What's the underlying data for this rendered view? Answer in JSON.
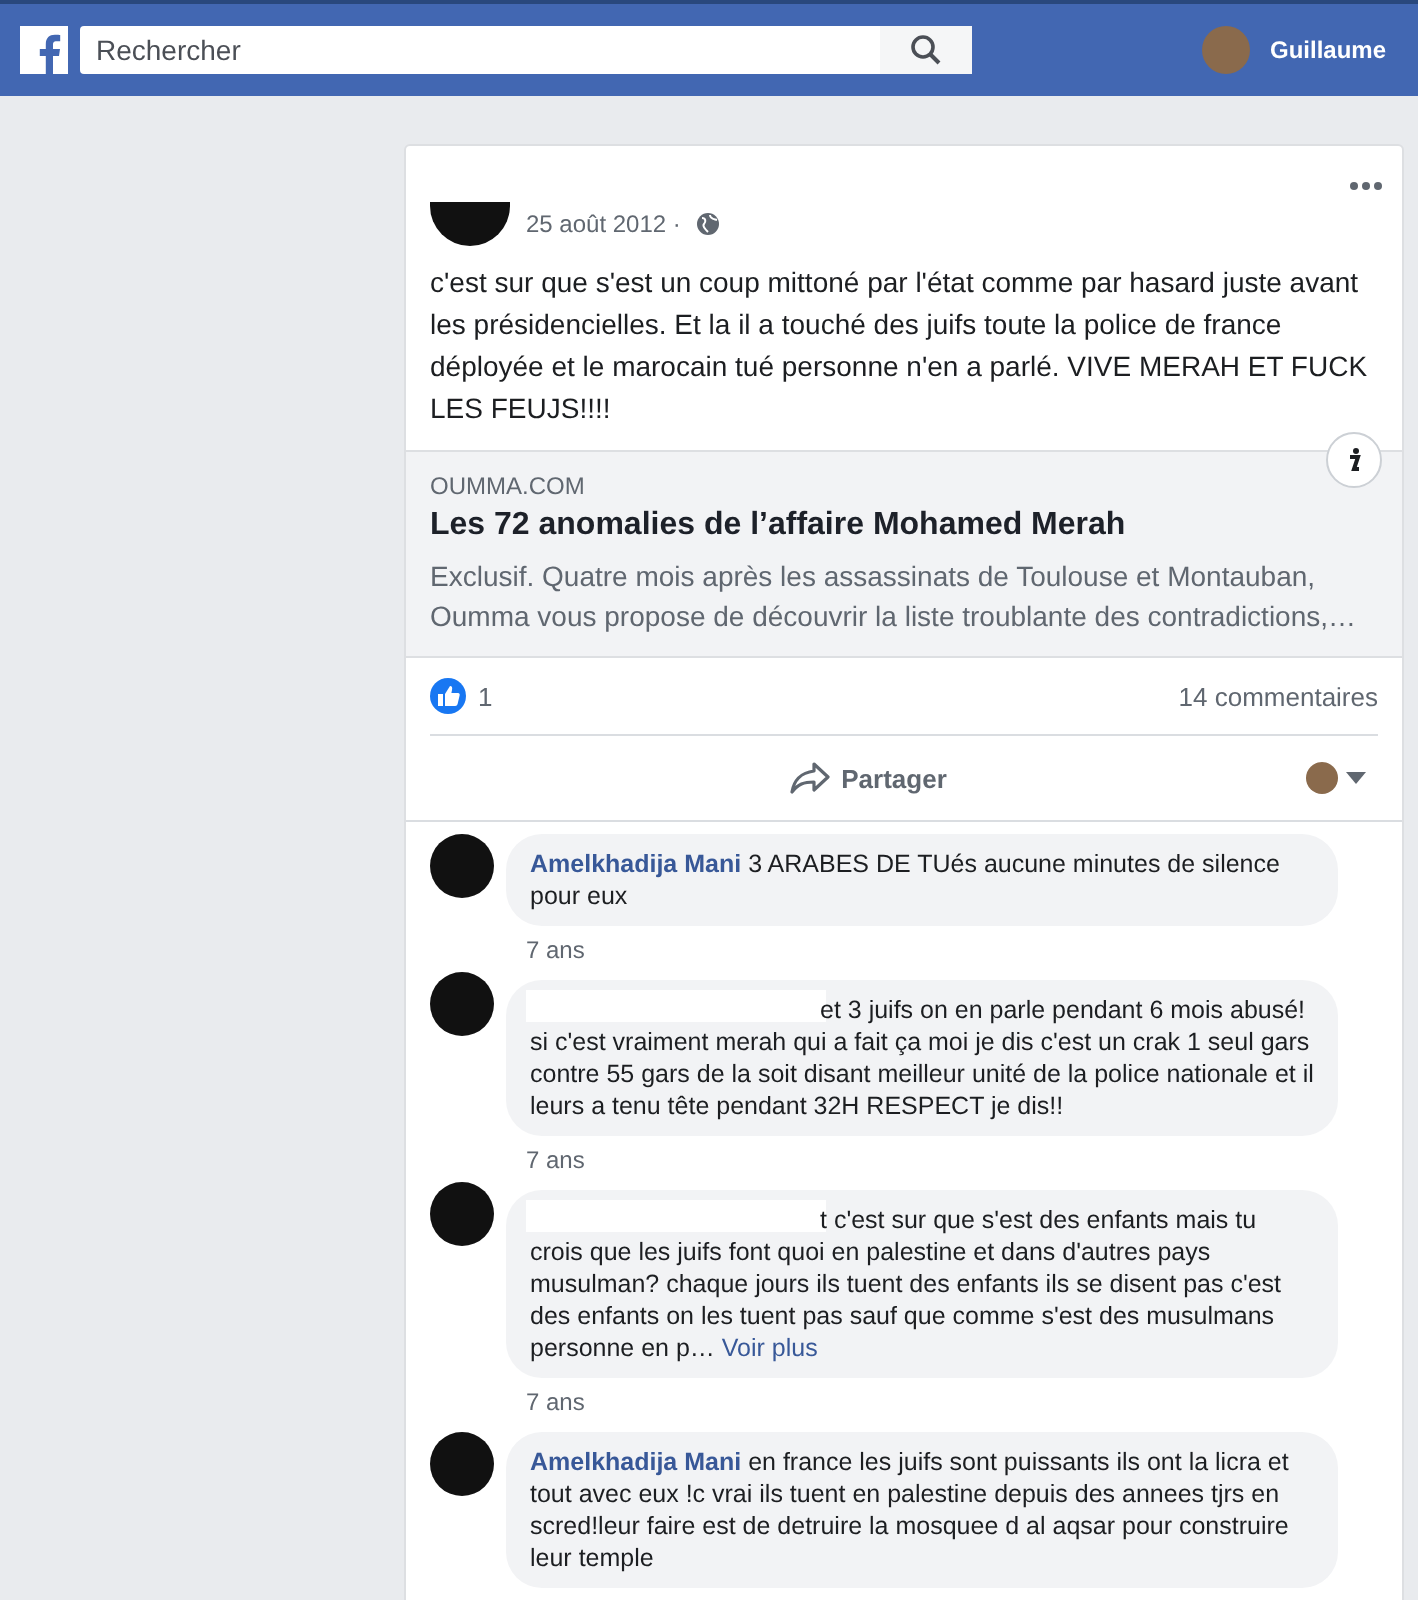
{
  "topbar": {
    "search": {
      "placeholder": "Rechercher"
    },
    "user": {
      "name": "Guillaume"
    }
  },
  "post": {
    "date": "25 août 2012 ·",
    "text": "c'est sur que s'est un coup mittoné par l'état comme par hasard juste avant les présidencielles. Et la il a touché des juifs toute la police de france déployée et le marocain tué personne n'en a parlé. VIVE MERAH ET FUCK LES FEUJS!!!!",
    "link": {
      "domain": "OUMMA.COM",
      "title": "Les 72 anomalies de l’affaire Mohamed Merah",
      "description": "Exclusif. Quatre mois après les assassinats de Toulouse et Montauban, Oumma vous propose de découvrir la liste troublante des contradictions,…"
    },
    "likes": "1",
    "comments_count": "14 commentaires",
    "share": "Partager"
  },
  "comments": [
    {
      "author": "Amelkhadija Mani",
      "author_redacted": false,
      "text": "3 ARABES DE TUés aucune minutes de silence pour eux",
      "time": "7 ans"
    },
    {
      "author_redacted": true,
      "text": "et 3 juifs on en parle pendant 6 mois abusé! si c'est vraiment merah qui a fait ça moi je dis c'est un crak 1 seul gars contre 55 gars de la soit disant meilleur unité de la police nationale et il leurs a tenu tête pendant 32H RESPECT je dis!!",
      "time": "7 ans"
    },
    {
      "author_redacted": true,
      "text": "t c'est sur que s'est des enfants mais tu crois que les juifs font quoi en palestine et dans d'autres pays musulman? chaque jours ils tuent des enfants ils se disent pas c'est des enfants on les tuent pas sauf que comme s'est des musulmans personne en p…",
      "more": "Voir plus",
      "time": "7 ans"
    },
    {
      "author": "Amelkhadija Mani",
      "author_redacted": false,
      "text": "en france les juifs sont puissants ils ont la licra et tout avec eux !c vrai ils tuent en palestine depuis des annees tjrs en scred!leur faire est de detruire la mosquee d al aqsar pour construire leur temple"
    }
  ]
}
